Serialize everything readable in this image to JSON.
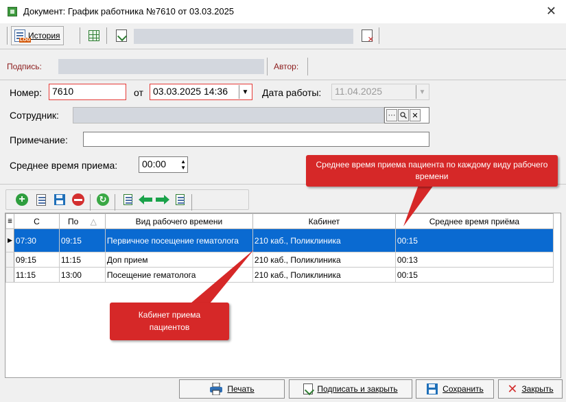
{
  "window": {
    "title": "Документ: График работника №7610 от 03.03.2025",
    "close_glyph": "✕"
  },
  "toolbar": {
    "history_label": "История",
    "history_log_badge": "LOG"
  },
  "signature_row": {
    "signature_label": "Подпись:",
    "author_label": "Автор:"
  },
  "form": {
    "number_label": "Номер:",
    "number_value": "7610",
    "from_label": "от",
    "date_value": "03.03.2025 14:36",
    "work_date_label": "Дата работы:",
    "work_date_value": "11.04.2025",
    "employee_label": "Сотрудник:",
    "note_label": "Примечание:",
    "note_value": "",
    "avg_time_label": "Среднее время приема:",
    "avg_time_value": "00:00"
  },
  "grid": {
    "columns": [
      "С",
      "По",
      "Вид рабочего времени",
      "Кабинет",
      "Среднее время приёма"
    ],
    "sort_indicator": "△",
    "rows": [
      {
        "from": "07:30",
        "to": "09:15",
        "type": "Первичное посещение гематолога",
        "room": "210 каб., Поликлиника",
        "avg": "00:15",
        "selected": true
      },
      {
        "from": "09:15",
        "to": "11:15",
        "type": "Доп прием",
        "room": "210 каб., Поликлиника",
        "avg": "00:13",
        "selected": false
      },
      {
        "from": "11:15",
        "to": "13:00",
        "type": "Посещение гематолога",
        "room": "210 каб., Поликлиника",
        "avg": "00:15",
        "selected": false
      }
    ]
  },
  "callouts": {
    "avg_time": "Среднее время приема пациента по каждому виду рабочего времени",
    "room": "Кабинет приема пациентов"
  },
  "footer": {
    "print_label": "Печать",
    "sign_close_label": "Подписать и закрыть",
    "save_label": "Сохранить",
    "close_label": "Закрыть"
  },
  "colors": {
    "selection": "#0a6ad1",
    "callout": "#d62828",
    "required_border": "#e53935",
    "label_red": "#8b1a1a"
  },
  "icons": [
    "document-icon",
    "log-history-icon",
    "table-icon",
    "sign-icon",
    "unsign-icon",
    "add-icon",
    "edit-icon",
    "save-icon",
    "delete-icon",
    "refresh-icon",
    "arrow-left-icon",
    "arrow-right-icon",
    "printer-icon",
    "close-icon"
  ]
}
